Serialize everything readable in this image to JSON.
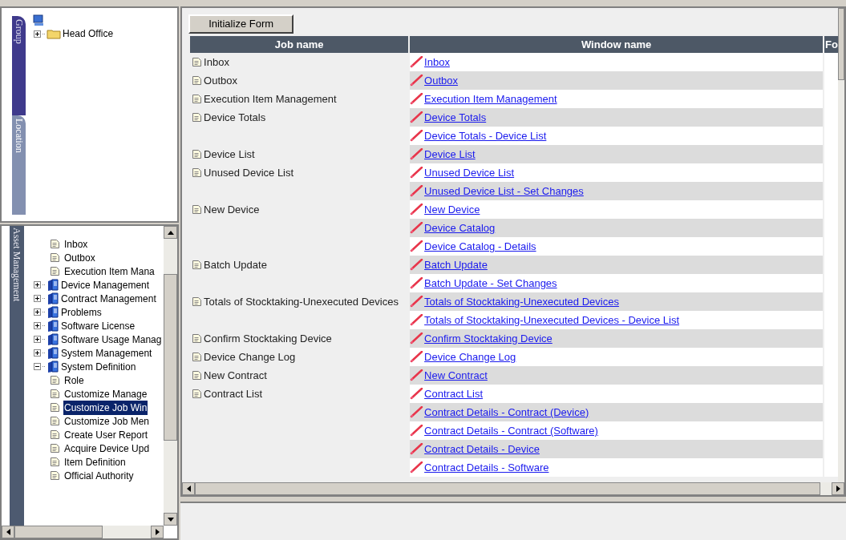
{
  "side_tabs": [
    {
      "label": "Group",
      "selected": true
    },
    {
      "label": "Location",
      "selected": false
    }
  ],
  "group_tree": [
    {
      "label": "Head Office",
      "kind": "folder",
      "expanded": false
    }
  ],
  "module_label": "Asset Management",
  "menu_tree": [
    {
      "kind": "continued",
      "children": [
        {
          "label": "Inbox",
          "kind": "page",
          "selected": false
        },
        {
          "label": "Outbox",
          "kind": "page",
          "selected": false
        },
        {
          "label": "Execution Item Mana",
          "kind": "page",
          "selected": false
        }
      ]
    },
    {
      "label": "Device Management",
      "kind": "book",
      "expanded": false
    },
    {
      "label": "Contract Management",
      "kind": "book",
      "expanded": false
    },
    {
      "label": "Problems",
      "kind": "book",
      "expanded": false
    },
    {
      "label": "Software License",
      "kind": "book",
      "expanded": false
    },
    {
      "label": "Software Usage Manag",
      "kind": "book",
      "expanded": false
    },
    {
      "label": "System Management",
      "kind": "book",
      "expanded": false
    },
    {
      "label": "System Definition",
      "kind": "book",
      "expanded": true,
      "children": [
        {
          "label": "Role",
          "kind": "page",
          "selected": false
        },
        {
          "label": "Customize Manage",
          "kind": "page",
          "selected": false
        },
        {
          "label": "Customize Job Win",
          "kind": "page",
          "selected": true
        },
        {
          "label": "Customize Job Men",
          "kind": "page",
          "selected": false
        },
        {
          "label": "Create User Report",
          "kind": "page",
          "selected": false
        },
        {
          "label": "Acquire Device Upd",
          "kind": "page",
          "selected": false
        },
        {
          "label": "Item Definition",
          "kind": "page",
          "selected": false
        },
        {
          "label": "Official Authority",
          "kind": "page",
          "selected": false
        }
      ]
    }
  ],
  "toolbar": {
    "button": "Initialize Form"
  },
  "table": {
    "columns": [
      "Job name",
      "Window name",
      "Fo"
    ],
    "rows": [
      {
        "job": "Inbox",
        "window": "Inbox"
      },
      {
        "job": "Outbox",
        "window": "Outbox"
      },
      {
        "job": "Execution Item Management",
        "window": "Execution Item Management"
      },
      {
        "job": "Device Totals",
        "window": "Device Totals"
      },
      {
        "window": "Device Totals - Device List"
      },
      {
        "job": "Device List",
        "window": "Device List"
      },
      {
        "job": "Unused Device List",
        "window": "Unused Device List"
      },
      {
        "window": "Unused Device List - Set Changes"
      },
      {
        "job": "New Device",
        "window": "New Device"
      },
      {
        "window": "Device Catalog"
      },
      {
        "window": "Device Catalog - Details"
      },
      {
        "job": "Batch Update",
        "window": "Batch Update"
      },
      {
        "window": "Batch Update - Set Changes"
      },
      {
        "job": "Totals of Stocktaking-Unexecuted Devices",
        "window": "Totals of Stocktaking-Unexecuted Devices"
      },
      {
        "window": "Totals of Stocktaking-Unexecuted Devices - Device List"
      },
      {
        "job": "Confirm Stocktaking Device",
        "window": "Confirm Stocktaking Device"
      },
      {
        "job": "Device Change Log",
        "window": "Device Change Log"
      },
      {
        "job": "New Contract",
        "window": "New Contract"
      },
      {
        "job": "Contract List",
        "window": "Contract List"
      },
      {
        "window": "Contract Details - Contract (Device)"
      },
      {
        "window": "Contract Details - Contract (Software)"
      },
      {
        "window": "Contract Details - Device"
      },
      {
        "window": "Contract Details - Software"
      }
    ]
  }
}
